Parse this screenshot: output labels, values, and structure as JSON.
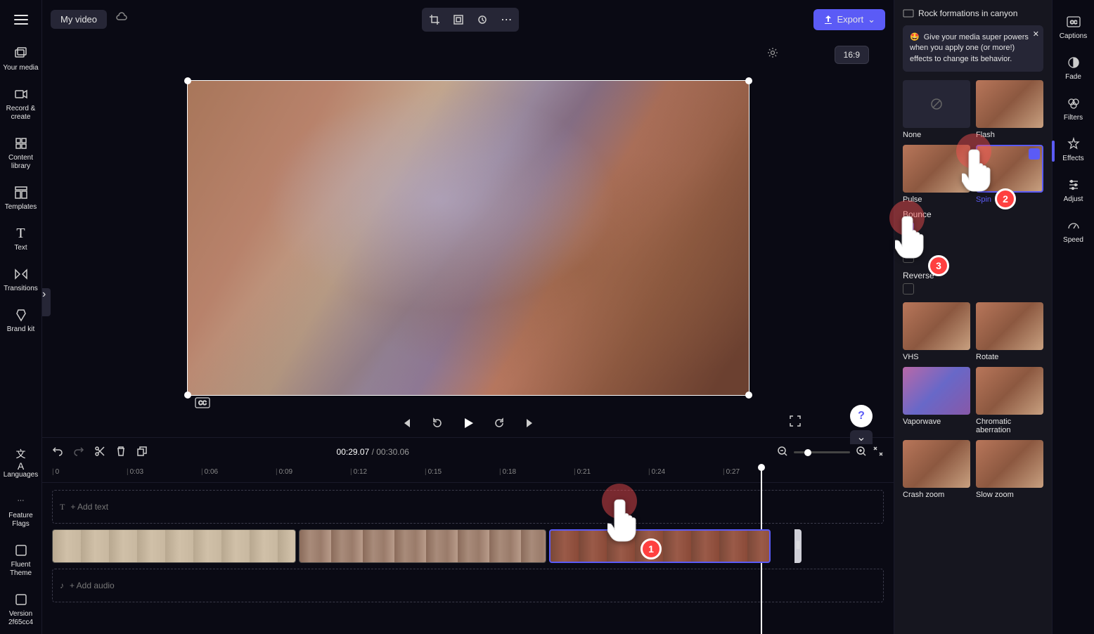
{
  "project_title": "My video",
  "export_label": "Export",
  "aspect_ratio": "16:9",
  "left_nav": [
    "Your media",
    "Record & create",
    "Content library",
    "Templates",
    "Text",
    "Transitions",
    "Brand kit"
  ],
  "left_bottom": [
    "Languages",
    "Feature Flags",
    "Fluent Theme",
    "Version 2f65cc4"
  ],
  "right_nav": [
    "Captions",
    "Fade",
    "Filters",
    "Effects",
    "Adjust",
    "Speed"
  ],
  "time": {
    "current": "00:29.07",
    "total": "00:30.06"
  },
  "ruler": [
    "0",
    "0:03",
    "0:06",
    "0:09",
    "0:12",
    "0:15",
    "0:18",
    "0:21",
    "0:24",
    "0:27"
  ],
  "track_text_placeholder": "+ Add text",
  "track_audio_placeholder": "+ Add audio",
  "clip_title": "Rock formations in canyon",
  "tip_text": "Give your media super powers when you apply one (or more!) effects to change its behavior.",
  "effects": [
    "None",
    "Flash",
    "Pulse",
    "Spin",
    "VHS",
    "Rotate",
    "Vaporwave",
    "Chromatic aberration",
    "Crash zoom",
    "Slow zoom"
  ],
  "options": {
    "bounce": "Bounce",
    "loop": "Loop",
    "reverse": "Reverse"
  },
  "annotations": {
    "1": "1",
    "2": "2",
    "3": "3"
  }
}
